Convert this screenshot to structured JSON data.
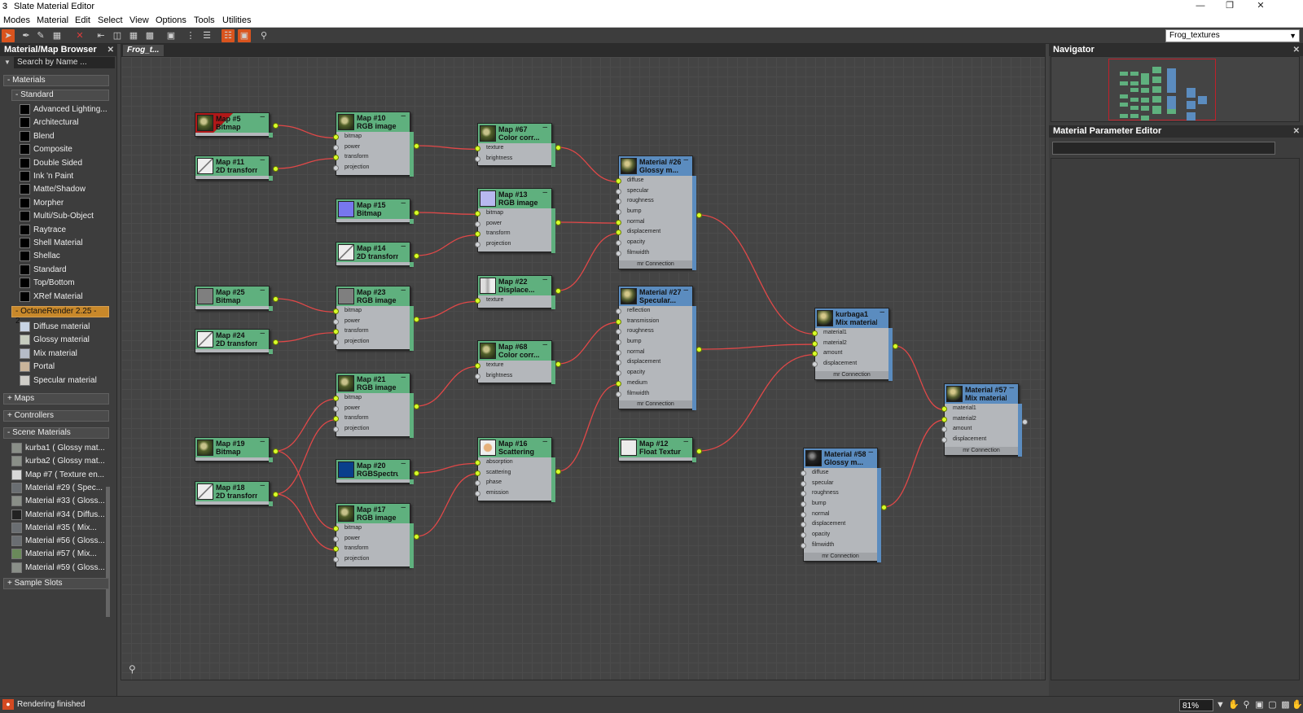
{
  "window": {
    "title": "Slate Material Editor"
  },
  "menu": [
    "Modes",
    "Material",
    "Edit",
    "Select",
    "View",
    "Options",
    "Tools",
    "Utilities"
  ],
  "toolbar": {
    "view_selector": "Frog_textures"
  },
  "browser": {
    "title": "Material/Map Browser",
    "search_placeholder": "Search by Name ...",
    "materials_label": "- Materials",
    "standard_label": "- Standard",
    "standard_items": [
      "Advanced Lighting...",
      "Architectural",
      "Blend",
      "Composite",
      "Double Sided",
      "Ink 'n Paint",
      "Matte/Shadow",
      "Morpher",
      "Multi/Sub-Object",
      "Raytrace",
      "Shell Material",
      "Shellac",
      "Standard",
      "Top/Bottom",
      "XRef Material"
    ],
    "octane_label": "- OctaneRender 2.25 - 2...",
    "octane_items": [
      "Diffuse material",
      "Glossy material",
      "Mix material",
      "Portal",
      "Specular material"
    ],
    "maps_label": "+ Maps",
    "controllers_label": "+ Controllers",
    "scene_label": "- Scene Materials",
    "scene_items": [
      "kurba1  ( Glossy mat...",
      "kurba2  ( Glossy mat...",
      "Map #7  ( Texture en...",
      "Material #29  ( Spec...",
      "Material #33  ( Gloss...",
      "Material #34  ( Diffus...",
      "Material #35  ( Mix...",
      "Material #56  ( Gloss...",
      "Material #57  ( Mix...",
      "Material #59  ( Gloss..."
    ],
    "sample_slots_label": "+ Sample Slots"
  },
  "view": {
    "tab_label": "Frog_t..."
  },
  "nodes": {
    "map5": {
      "name": "Map #5",
      "type": "Bitmap"
    },
    "map11": {
      "name": "Map #11",
      "type": "2D transform..."
    },
    "map10": {
      "name": "Map #10",
      "type": "RGB image",
      "slots": [
        "bitmap",
        "power",
        "transform",
        "projection"
      ]
    },
    "map67": {
      "name": "Map #67",
      "type": "Color corr...",
      "slots": [
        "texture",
        "brightness"
      ]
    },
    "map15": {
      "name": "Map #15",
      "type": "Bitmap"
    },
    "map14": {
      "name": "Map #14",
      "type": "2D transform..."
    },
    "map13": {
      "name": "Map #13",
      "type": "RGB image",
      "slots": [
        "bitmap",
        "power",
        "transform",
        "projection"
      ]
    },
    "mat26": {
      "name": "Material #26",
      "type": "Glossy m...",
      "slots": [
        "diffuse",
        "specular",
        "roughness",
        "bump",
        "normal",
        "displacement",
        "opacity",
        "filmwidth"
      ],
      "footer": "mr Connection"
    },
    "map25": {
      "name": "Map #25",
      "type": "Bitmap"
    },
    "map24": {
      "name": "Map #24",
      "type": "2D transform..."
    },
    "map23": {
      "name": "Map #23",
      "type": "RGB image",
      "slots": [
        "bitmap",
        "power",
        "transform",
        "projection"
      ]
    },
    "map22": {
      "name": "Map #22",
      "type": "Displace...",
      "slots": [
        "texture"
      ]
    },
    "mat27": {
      "name": "Material #27",
      "type": "Specular...",
      "slots": [
        "reflection",
        "transmission",
        "roughness",
        "bump",
        "normal",
        "displacement",
        "opacity",
        "medium",
        "filmwidth"
      ],
      "footer": "mr Connection"
    },
    "kurbaga1": {
      "name": "kurbaga1",
      "type": "Mix material",
      "slots": [
        "material1",
        "material2",
        "amount",
        "displacement"
      ],
      "footer": "mr Connection"
    },
    "map68": {
      "name": "Map #68",
      "type": "Color corr...",
      "slots": [
        "texture",
        "brightness"
      ]
    },
    "map21": {
      "name": "Map #21",
      "type": "RGB image",
      "slots": [
        "bitmap",
        "power",
        "transform",
        "projection"
      ]
    },
    "mat57": {
      "name": "Material #57",
      "type": "Mix material",
      "slots": [
        "material1",
        "material2",
        "amount",
        "displacement"
      ],
      "footer": "mr Connection"
    },
    "map19": {
      "name": "Map #19",
      "type": "Bitmap"
    },
    "map18": {
      "name": "Map #18",
      "type": "2D transform..."
    },
    "map20": {
      "name": "Map #20",
      "type": "RGBSpectru..."
    },
    "map16": {
      "name": "Map #16",
      "type": "Scattering",
      "slots": [
        "absorption",
        "scattering",
        "phase",
        "emission"
      ]
    },
    "map12": {
      "name": "Map #12",
      "type": "Float Texture"
    },
    "mat58": {
      "name": "Material #58",
      "type": "Glossy m...",
      "slots": [
        "diffuse",
        "specular",
        "roughness",
        "bump",
        "normal",
        "displacement",
        "opacity",
        "filmwidth"
      ],
      "footer": "mr Connection"
    },
    "map17": {
      "name": "Map #17",
      "type": "RGB image",
      "slots": [
        "bitmap",
        "power",
        "transform",
        "projection"
      ]
    }
  },
  "navigator": {
    "title": "Navigator"
  },
  "param_editor": {
    "title": "Material Parameter Editor"
  },
  "status": {
    "text": "Rendering finished",
    "zoom": "81%"
  },
  "colors": {
    "map_node": "#5fb07e",
    "material_node": "#5b8cbf",
    "wire": "#e04848",
    "pin_active": "#d8ff2a",
    "octane_header": "#c8882a"
  }
}
